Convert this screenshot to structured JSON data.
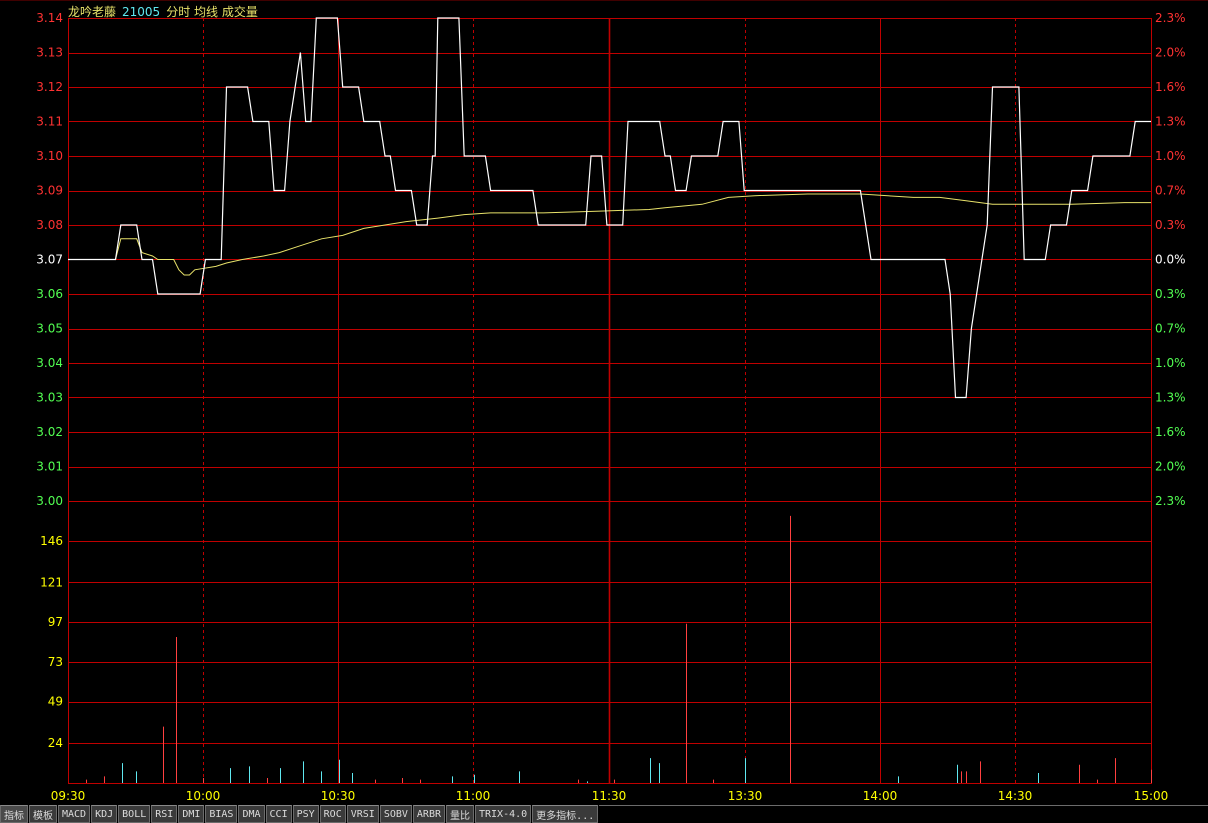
{
  "legend": {
    "stock_name": "龙吟老藤",
    "stock_code": "21005",
    "labels": "分时 均线 成交量"
  },
  "colors": {
    "price_line": "#ffffff",
    "avg_line": "#e8e26a",
    "grid": "#c00000",
    "up": "#ff3232",
    "down": "#52ff52",
    "flat": "#ffffff",
    "volume_up": "#ff4040",
    "volume_down": "#5fe8f0",
    "volume_axis": "#ffff00"
  },
  "chart_data": [
    {
      "type": "line",
      "x_ticks": [
        "09:30",
        "10:00",
        "10:30",
        "11:00",
        "11:30",
        "13:30",
        "14:00",
        "14:30",
        "15:00"
      ],
      "ylim": [
        3.0,
        3.14
      ],
      "y_ticks": [
        "3.14",
        "3.13",
        "3.12",
        "3.11",
        "3.10",
        "3.09",
        "3.08",
        "3.07",
        "3.06",
        "3.05",
        "3.04",
        "3.03",
        "3.02",
        "3.01",
        "3.00"
      ],
      "y_ticks_right": [
        "2.3%",
        "2.0%",
        "1.6%",
        "1.3%",
        "1.0%",
        "0.7%",
        "0.3%",
        "0.0%",
        "0.3%",
        "0.7%",
        "1.0%",
        "1.3%",
        "1.6%",
        "2.0%",
        "2.3%"
      ],
      "reference_price": 3.07,
      "series": [
        {
          "points": [
            [
              0,
              3.07
            ],
            [
              9,
              3.07
            ],
            [
              10,
              3.08
            ],
            [
              13,
              3.08
            ],
            [
              14,
              3.07
            ],
            [
              16,
              3.07
            ],
            [
              17,
              3.06
            ],
            [
              25,
              3.06
            ],
            [
              26,
              3.07
            ],
            [
              29,
              3.07
            ],
            [
              30,
              3.12
            ],
            [
              34,
              3.12
            ],
            [
              35,
              3.11
            ],
            [
              38,
              3.11
            ],
            [
              39,
              3.09
            ],
            [
              41,
              3.09
            ],
            [
              42,
              3.11
            ],
            [
              44,
              3.13
            ],
            [
              45,
              3.11
            ],
            [
              46,
              3.11
            ],
            [
              47,
              3.14
            ],
            [
              51,
              3.14
            ],
            [
              52,
              3.12
            ],
            [
              55,
              3.12
            ],
            [
              56,
              3.11
            ],
            [
              59,
              3.11
            ],
            [
              60,
              3.1
            ],
            [
              61,
              3.1
            ],
            [
              62,
              3.09
            ],
            [
              65,
              3.09
            ],
            [
              66,
              3.08
            ],
            [
              68,
              3.08
            ],
            [
              69,
              3.1
            ],
            [
              69.5,
              3.1
            ],
            [
              70,
              3.14
            ],
            [
              74,
              3.14
            ],
            [
              75,
              3.1
            ],
            [
              79,
              3.1
            ],
            [
              80,
              3.09
            ],
            [
              88,
              3.09
            ],
            [
              89,
              3.08
            ],
            [
              98,
              3.08
            ],
            [
              99,
              3.1
            ],
            [
              101,
              3.1
            ],
            [
              102,
              3.08
            ],
            [
              105,
              3.08
            ],
            [
              106,
              3.11
            ],
            [
              112,
              3.11
            ],
            [
              113,
              3.1
            ],
            [
              114,
              3.1
            ],
            [
              115,
              3.09
            ],
            [
              117,
              3.09
            ],
            [
              118,
              3.1
            ],
            [
              123,
              3.1
            ],
            [
              124,
              3.11
            ],
            [
              127,
              3.11
            ],
            [
              128,
              3.09
            ],
            [
              150,
              3.09
            ],
            [
              151,
              3.08
            ],
            [
              152,
              3.07
            ],
            [
              166,
              3.07
            ],
            [
              167,
              3.06
            ],
            [
              168,
              3.03
            ],
            [
              170,
              3.03
            ],
            [
              171,
              3.05
            ],
            [
              173,
              3.07
            ],
            [
              174,
              3.08
            ],
            [
              175,
              3.12
            ],
            [
              180,
              3.12
            ],
            [
              181,
              3.07
            ],
            [
              185,
              3.07
            ],
            [
              186,
              3.08
            ],
            [
              189,
              3.08
            ],
            [
              190,
              3.09
            ],
            [
              193,
              3.09
            ],
            [
              194,
              3.1
            ],
            [
              201,
              3.1
            ],
            [
              202,
              3.11
            ],
            [
              205,
              3.11
            ]
          ]
        },
        {
          "points": [
            [
              0,
              3.07
            ],
            [
              9,
              3.07
            ],
            [
              10,
              3.076
            ],
            [
              13,
              3.076
            ],
            [
              14,
              3.072
            ],
            [
              16,
              3.071
            ],
            [
              17,
              3.07
            ],
            [
              20,
              3.07
            ],
            [
              21,
              3.067
            ],
            [
              22,
              3.0655
            ],
            [
              23,
              3.0655
            ],
            [
              24,
              3.067
            ],
            [
              28,
              3.068
            ],
            [
              30,
              3.069
            ],
            [
              33,
              3.07
            ],
            [
              37,
              3.071
            ],
            [
              40,
              3.072
            ],
            [
              44,
              3.074
            ],
            [
              48,
              3.076
            ],
            [
              52,
              3.077
            ],
            [
              56,
              3.079
            ],
            [
              60,
              3.08
            ],
            [
              64,
              3.081
            ],
            [
              70,
              3.082
            ],
            [
              75,
              3.083
            ],
            [
              80,
              3.0835
            ],
            [
              90,
              3.0835
            ],
            [
              100,
              3.084
            ],
            [
              110,
              3.0845
            ],
            [
              113,
              3.085
            ],
            [
              120,
              3.086
            ],
            [
              125,
              3.088
            ],
            [
              130,
              3.0885
            ],
            [
              140,
              3.089
            ],
            [
              150,
              3.089
            ],
            [
              160,
              3.088
            ],
            [
              165,
              3.088
            ],
            [
              170,
              3.087
            ],
            [
              175,
              3.086
            ],
            [
              185,
              3.086
            ],
            [
              190,
              3.086
            ],
            [
              200,
              3.0865
            ],
            [
              205,
              3.0865
            ]
          ]
        }
      ]
    },
    {
      "type": "bar",
      "x_ticks": [
        "09:30",
        "10:00",
        "10:30",
        "11:00",
        "11:30",
        "13:30",
        "14:00",
        "14:30",
        "15:00"
      ],
      "ylim": [
        0,
        170
      ],
      "y_ticks": [
        "146",
        "121",
        "97",
        "73",
        "49",
        "24"
      ],
      "series": [
        {
          "points": [
            [
              4,
              2,
              "up"
            ],
            [
              8,
              4,
              "up"
            ],
            [
              12,
              12,
              "down"
            ],
            [
              15,
              7,
              "down"
            ],
            [
              21,
              34,
              "up"
            ],
            [
              24,
              88,
              "up"
            ],
            [
              30,
              3,
              "up"
            ],
            [
              36,
              9,
              "down"
            ],
            [
              40,
              10,
              "down"
            ],
            [
              44,
              3,
              "up"
            ],
            [
              47,
              9,
              "down"
            ],
            [
              52,
              13,
              "down"
            ],
            [
              56,
              7,
              "down"
            ],
            [
              60,
              14,
              "down"
            ],
            [
              63,
              6,
              "down"
            ],
            [
              68,
              2,
              "up"
            ],
            [
              74,
              3,
              "up"
            ],
            [
              78,
              2,
              "up"
            ],
            [
              85,
              4,
              "down"
            ],
            [
              90,
              5,
              "down"
            ],
            [
              100,
              7,
              "down"
            ],
            [
              113,
              2,
              "up"
            ],
            [
              115,
              1,
              "down"
            ],
            [
              121,
              2,
              "up"
            ],
            [
              129,
              15,
              "down"
            ],
            [
              131,
              12,
              "down"
            ],
            [
              137,
              96,
              "up"
            ],
            [
              143,
              2,
              "up"
            ],
            [
              150,
              15,
              "down"
            ],
            [
              160,
              161,
              "up"
            ],
            [
              184,
              4,
              "down"
            ],
            [
              197,
              11,
              "down"
            ],
            [
              198,
              7,
              "up"
            ],
            [
              199,
              7,
              "up"
            ],
            [
              202,
              13,
              "up"
            ],
            [
              215,
              6,
              "down"
            ],
            [
              224,
              11,
              "up"
            ],
            [
              228,
              2,
              "up"
            ],
            [
              232,
              15,
              "up"
            ],
            [
              240,
              8,
              "up"
            ]
          ]
        }
      ]
    }
  ],
  "bottom_tabs": [
    "指标",
    "模板",
    "MACD",
    "KDJ",
    "BOLL",
    "RSI",
    "DMI",
    "BIAS",
    "DMA",
    "CCI",
    "PSY",
    "ROC",
    "VRSI",
    "SOBV",
    "ARBR",
    "量比",
    "TRIX-4.0",
    "更多指标..."
  ]
}
